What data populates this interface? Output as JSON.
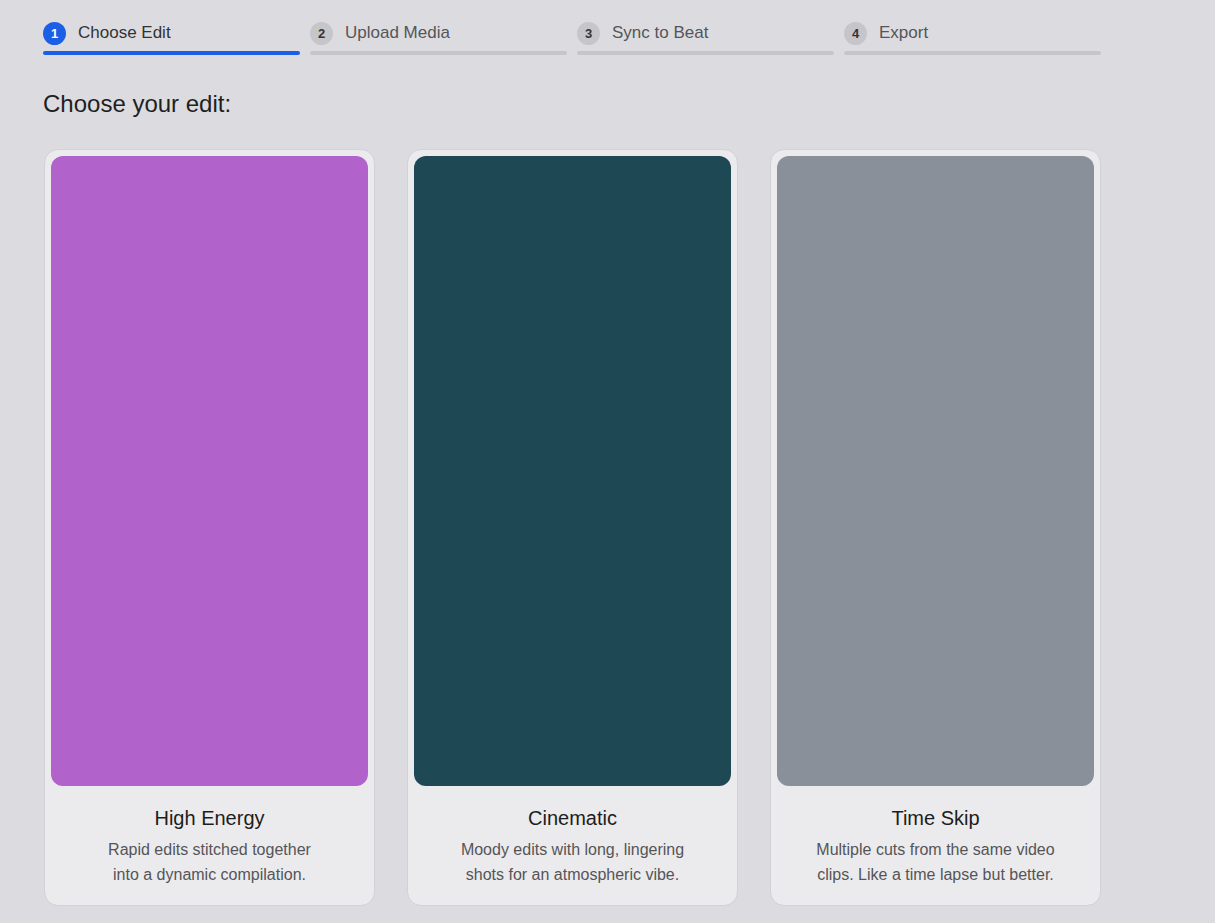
{
  "steps": [
    {
      "number": "1",
      "label": "Choose Edit",
      "selected": true
    },
    {
      "number": "2",
      "label": "Upload Media",
      "selected": false
    },
    {
      "number": "3",
      "label": "Sync to Beat",
      "selected": false
    },
    {
      "number": "4",
      "label": "Export",
      "selected": false
    }
  ],
  "heading": "Choose your edit:",
  "cards": [
    {
      "title": "High Energy",
      "description": [
        "Rapid edits stitched together",
        "into a dynamic compilation."
      ],
      "color": "#b262cb"
    },
    {
      "title": "Cinematic",
      "description": [
        "Moody edits with long, lingering",
        "shots for an atmospheric vibe."
      ],
      "color": "#1e4854"
    },
    {
      "title": "Time Skip",
      "description": [
        "Multiple cuts from the same video",
        "clips. Like a time lapse but better."
      ],
      "color": "#8a9099"
    }
  ]
}
